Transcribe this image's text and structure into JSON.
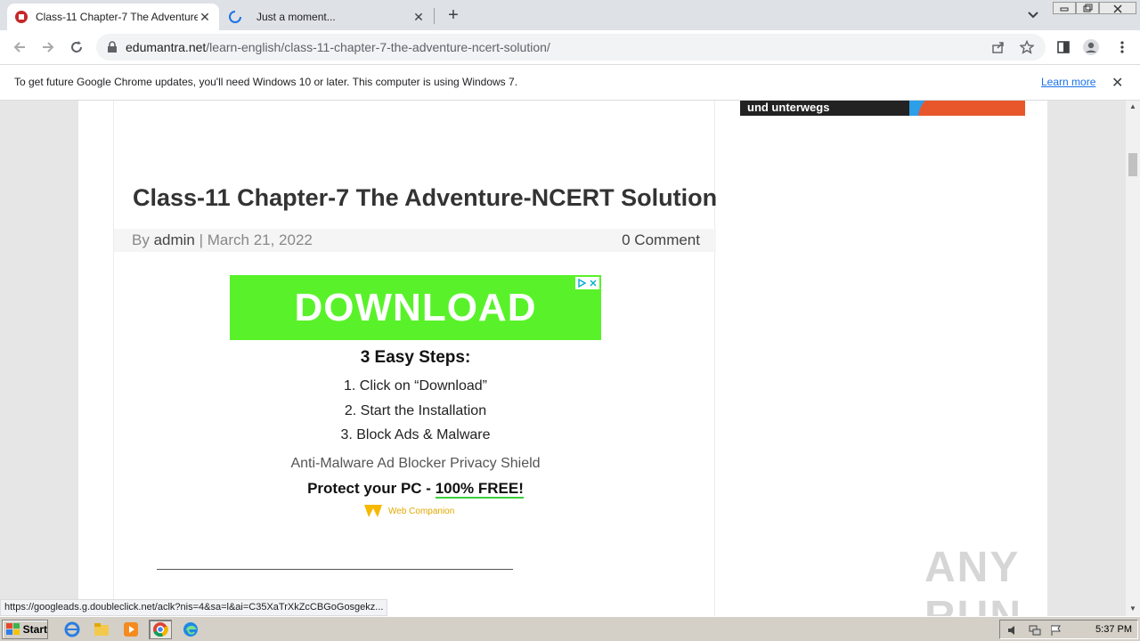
{
  "browser": {
    "tabs": [
      {
        "title": "Class-11 Chapter-7 The Adventure-N",
        "active": true
      },
      {
        "title": "Just a moment...",
        "active": false
      }
    ],
    "url_host": "edumantra.net",
    "url_path": "/learn-english/class-11-chapter-7-the-adventure-ncert-solution/",
    "infobar_message": "To get future Google Chrome updates, you'll need Windows 10 or later. This computer is using Windows 7.",
    "infobar_link": "Learn more"
  },
  "article": {
    "title": "Class-11 Chapter-7 The Adventure-NCERT Solution",
    "by_prefix": "By ",
    "author": "admin",
    "separator": " | ",
    "date": "March 21, 2022",
    "comments": "0 Comment"
  },
  "ad": {
    "download_label": "DOWNLOAD",
    "steps_title": "3 Easy Steps:",
    "steps": [
      "1. Click on “Download”",
      "2. Start the Installation",
      "3. Block Ads & Malware"
    ],
    "features": "Anti-Malware Ad Blocker Privacy Shield",
    "protect_prefix": "Protect your PC - ",
    "protect_free": "100% FREE!",
    "brand": "Web Companion"
  },
  "sidebar_banner_text": "und unterwegs",
  "status_url": "https://googleads.g.doubleclick.net/aclk?nis=4&sa=l&ai=C35XaTrXkZcCBGoGosgekz...",
  "watermark": "ANY RUN",
  "taskbar": {
    "start_label": "Start",
    "clock": "5:37 PM"
  }
}
